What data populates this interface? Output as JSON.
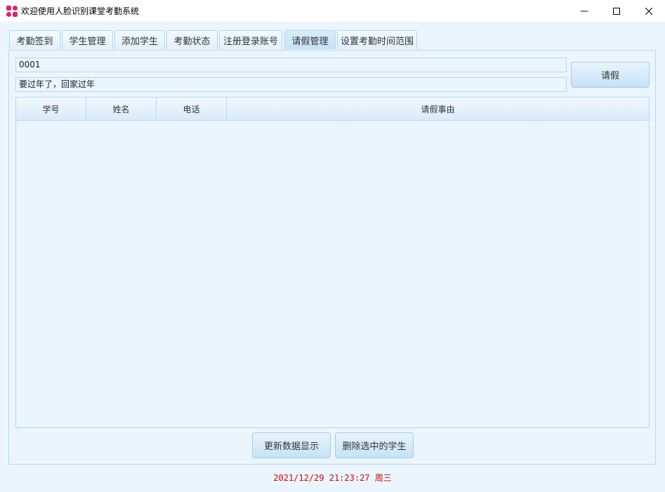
{
  "window": {
    "title": "欢迎使用人脸识别课堂考勤系统",
    "app_icon": "app-logo-icon",
    "controls": [
      "minimize-icon",
      "maximize-icon",
      "close-icon"
    ]
  },
  "tabs": [
    {
      "label": "考勤签到",
      "active": false
    },
    {
      "label": "学生管理",
      "active": false
    },
    {
      "label": "添加学生",
      "active": false
    },
    {
      "label": "考勤状态",
      "active": false
    },
    {
      "label": "注册登录账号",
      "active": false
    },
    {
      "label": "请假管理",
      "active": true
    },
    {
      "label": "设置考勤时间范围",
      "active": false
    }
  ],
  "leave_form": {
    "student_id_value": "0001",
    "reason_value": "要过年了，回家过年",
    "submit_label": "请假"
  },
  "table": {
    "columns": [
      "学号",
      "姓名",
      "电话",
      "请假事由"
    ],
    "rows": []
  },
  "actions": {
    "refresh_label": "更新数据显示",
    "delete_label": "删除选中的学生"
  },
  "status": {
    "clock_text": "2021/12/29 21:23:27 周三"
  },
  "colors": {
    "background": "#eaf5fd",
    "border": "#b9d7ee",
    "clock": "#d40000",
    "logo": "#e0226e"
  }
}
